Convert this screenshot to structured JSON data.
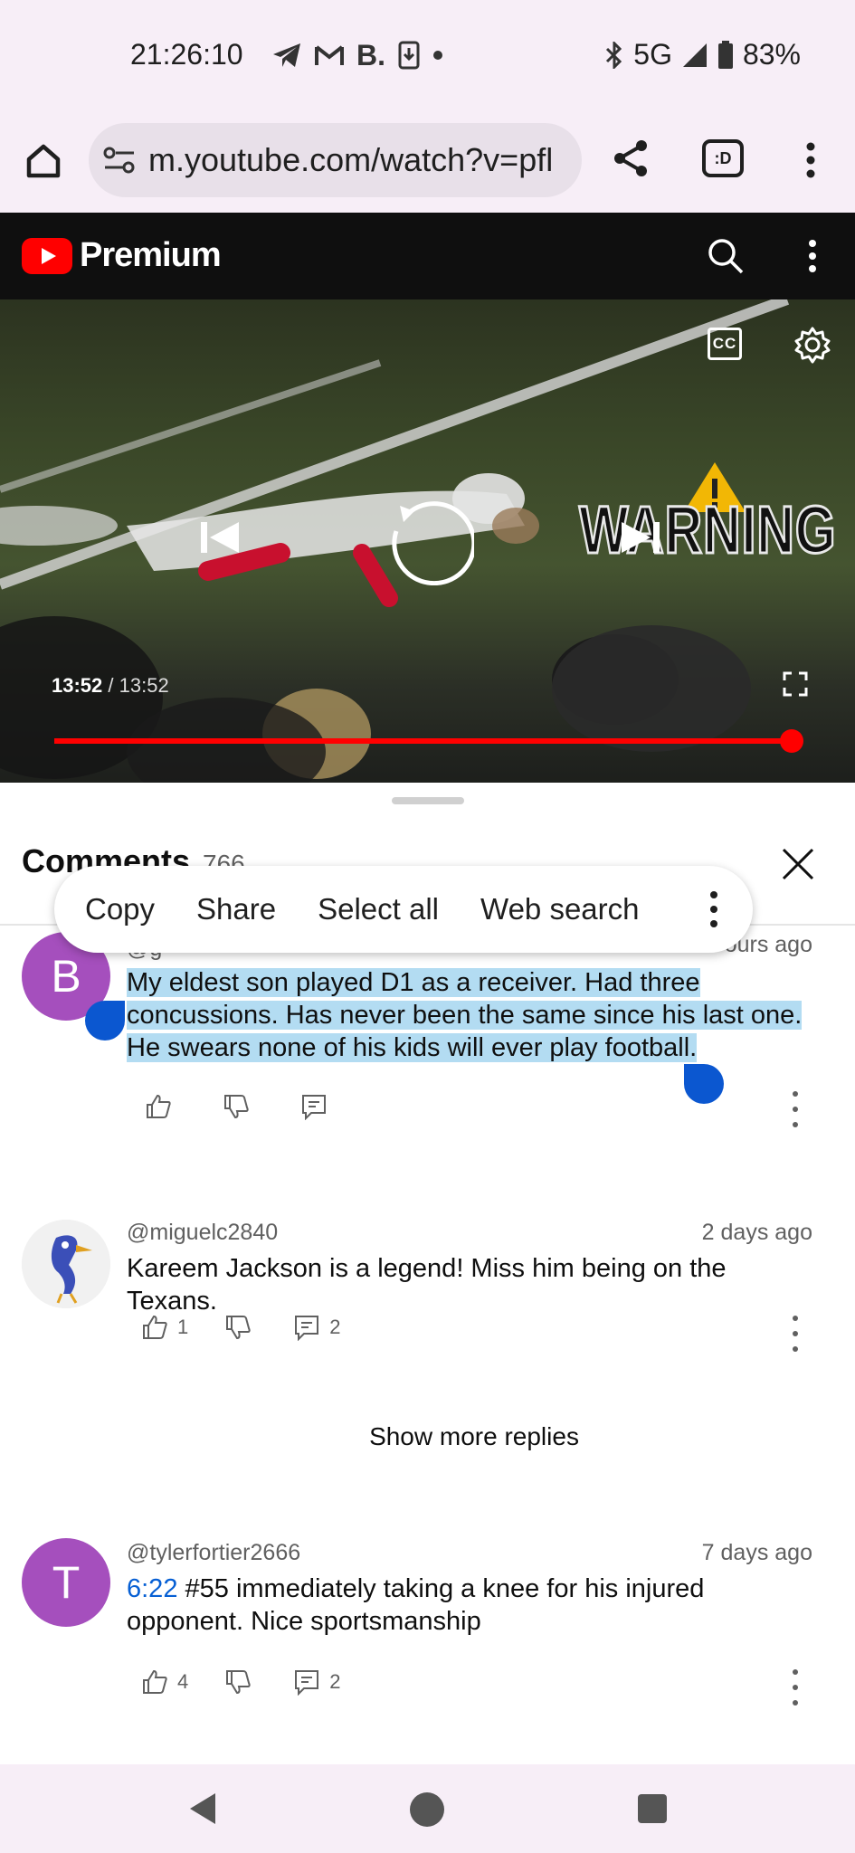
{
  "status_bar": {
    "time": "21:26:10",
    "network": "5G",
    "battery": "83%"
  },
  "browser": {
    "url": "m.youtube.com/watch?v=pfl",
    "tab_icon_label": ":D"
  },
  "yt_header": {
    "logo_text": "Premium"
  },
  "player": {
    "current_time": "13:52",
    "separator": " / ",
    "total_time": "13:52",
    "progress_fraction": 1.0,
    "overlay_text": "WARNING"
  },
  "comments": {
    "title": "Comments",
    "count": "766",
    "context_menu": {
      "copy": "Copy",
      "share": "Share",
      "select_all": "Select all",
      "web_search": "Web search"
    },
    "items": [
      {
        "avatar_letter": "B",
        "avatar_color": "#a54fbd",
        "author": "@g",
        "time": "ours ago",
        "text_lines": [
          "My eldest son played D1 as a receiver. Had three",
          "concussions. Has never been the same since his last one.",
          "He swears none of his kids will ever play football."
        ],
        "likes": "",
        "replies": ""
      },
      {
        "avatar_letter": "",
        "author": "@miguelc2840",
        "time": "2 days ago",
        "text": "Kareem Jackson is a legend! Miss him being on the Texans.",
        "likes": "1",
        "replies": "2"
      },
      {
        "avatar_letter": "T",
        "avatar_color": "#a54fbd",
        "author": "@tylerfortier2666",
        "time": "7 days ago",
        "timestamp_link": "6:22",
        "text_line1": " #55 immediately taking a knee for his injured",
        "text_line2": "opponent. Nice sportsmanship",
        "likes": "4",
        "replies": "2"
      }
    ],
    "show_more_replies": "Show more replies"
  }
}
